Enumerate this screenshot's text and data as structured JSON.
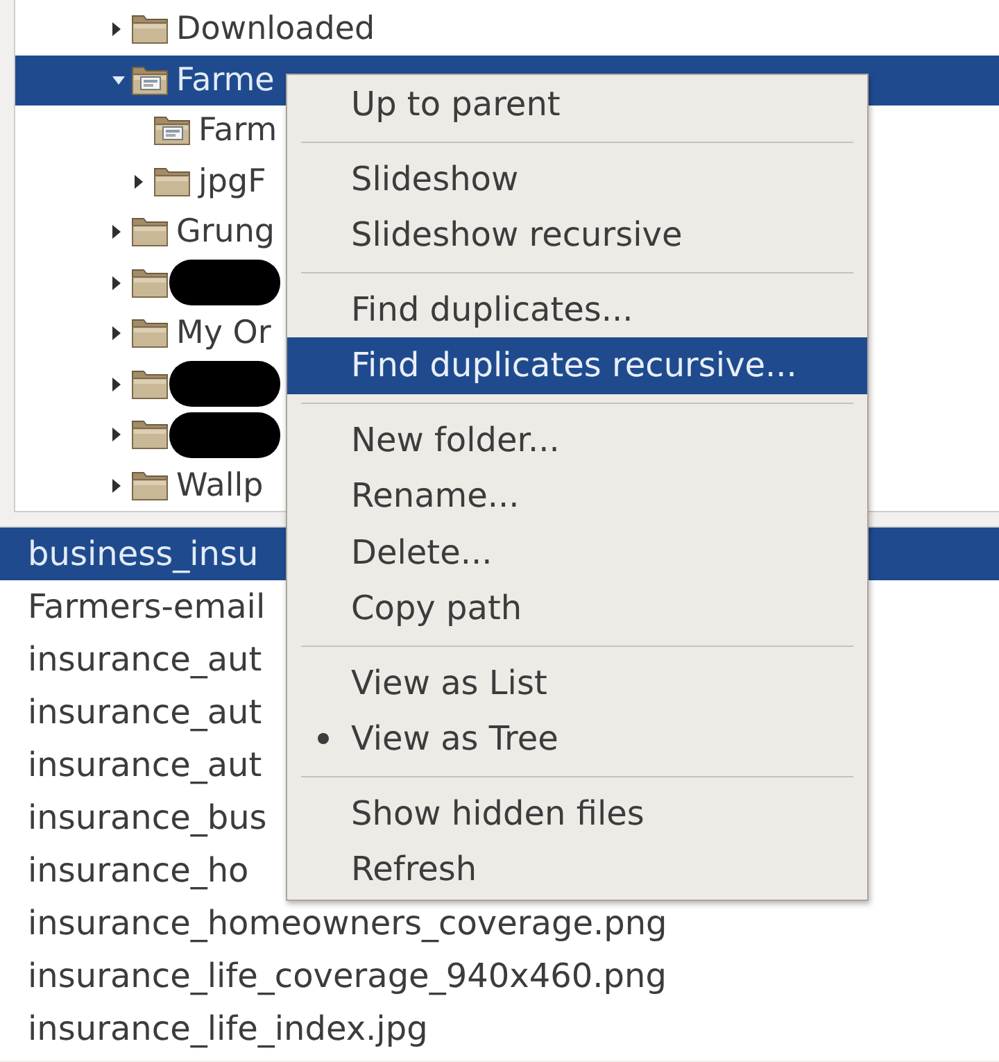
{
  "tree": {
    "items": [
      {
        "label": "Downloaded",
        "kind": "folder",
        "expanded": false,
        "selected": false,
        "redacted": false
      },
      {
        "label": "Farme",
        "kind": "picture-folder",
        "expanded": true,
        "selected": true,
        "redacted": false,
        "children": [
          {
            "label": "Farm",
            "kind": "picture-folder",
            "selected": false,
            "redacted": false
          },
          {
            "label": "jpgF",
            "kind": "folder",
            "expanded": false,
            "selected": false,
            "redacted": false
          }
        ]
      },
      {
        "label": "Grung",
        "kind": "folder",
        "expanded": false,
        "selected": false,
        "redacted": false
      },
      {
        "kind": "folder",
        "expanded": false,
        "selected": false,
        "redacted": true
      },
      {
        "label": "My Or",
        "kind": "folder",
        "expanded": false,
        "selected": false,
        "redacted": false
      },
      {
        "kind": "folder",
        "expanded": false,
        "selected": false,
        "redacted": true
      },
      {
        "kind": "folder",
        "expanded": false,
        "selected": false,
        "redacted": true
      },
      {
        "label": "Wallp",
        "kind": "folder",
        "expanded": false,
        "selected": false,
        "redacted": false
      }
    ]
  },
  "file_list": {
    "items": [
      {
        "label": "business_insu",
        "selected": true
      },
      {
        "label": "Farmers-email",
        "selected": false
      },
      {
        "label": "insurance_aut",
        "selected": false
      },
      {
        "label": "insurance_aut",
        "selected": false
      },
      {
        "label": "insurance_aut",
        "selected": false
      },
      {
        "label": "insurance_bus",
        "selected": false
      },
      {
        "label": "insurance_ho",
        "selected": false
      },
      {
        "label": "insurance_homeowners_coverage.png",
        "selected": false
      },
      {
        "label": "insurance_life_coverage_940x460.png",
        "selected": false
      },
      {
        "label": "insurance_life_index.jpg",
        "selected": false
      }
    ]
  },
  "context_menu": {
    "items": [
      {
        "kind": "action",
        "label": "Up to parent",
        "highlighted": false
      },
      {
        "kind": "separator"
      },
      {
        "kind": "action",
        "label": "Slideshow",
        "highlighted": false
      },
      {
        "kind": "action",
        "label": "Slideshow recursive",
        "highlighted": false
      },
      {
        "kind": "separator"
      },
      {
        "kind": "action",
        "label": "Find duplicates...",
        "highlighted": false
      },
      {
        "kind": "action",
        "label": "Find duplicates recursive...",
        "highlighted": true
      },
      {
        "kind": "separator"
      },
      {
        "kind": "action",
        "label": "New folder...",
        "highlighted": false
      },
      {
        "kind": "action",
        "label": "Rename...",
        "highlighted": false
      },
      {
        "kind": "action",
        "label": "Delete...",
        "highlighted": false
      },
      {
        "kind": "action",
        "label": "Copy path",
        "highlighted": false
      },
      {
        "kind": "separator"
      },
      {
        "kind": "radio",
        "label": "View as List",
        "selected": false,
        "highlighted": false
      },
      {
        "kind": "radio",
        "label": "View as Tree",
        "selected": true,
        "highlighted": false
      },
      {
        "kind": "separator"
      },
      {
        "kind": "action",
        "label": "Show hidden files",
        "highlighted": false
      },
      {
        "kind": "action",
        "label": "Refresh",
        "highlighted": false
      }
    ]
  }
}
